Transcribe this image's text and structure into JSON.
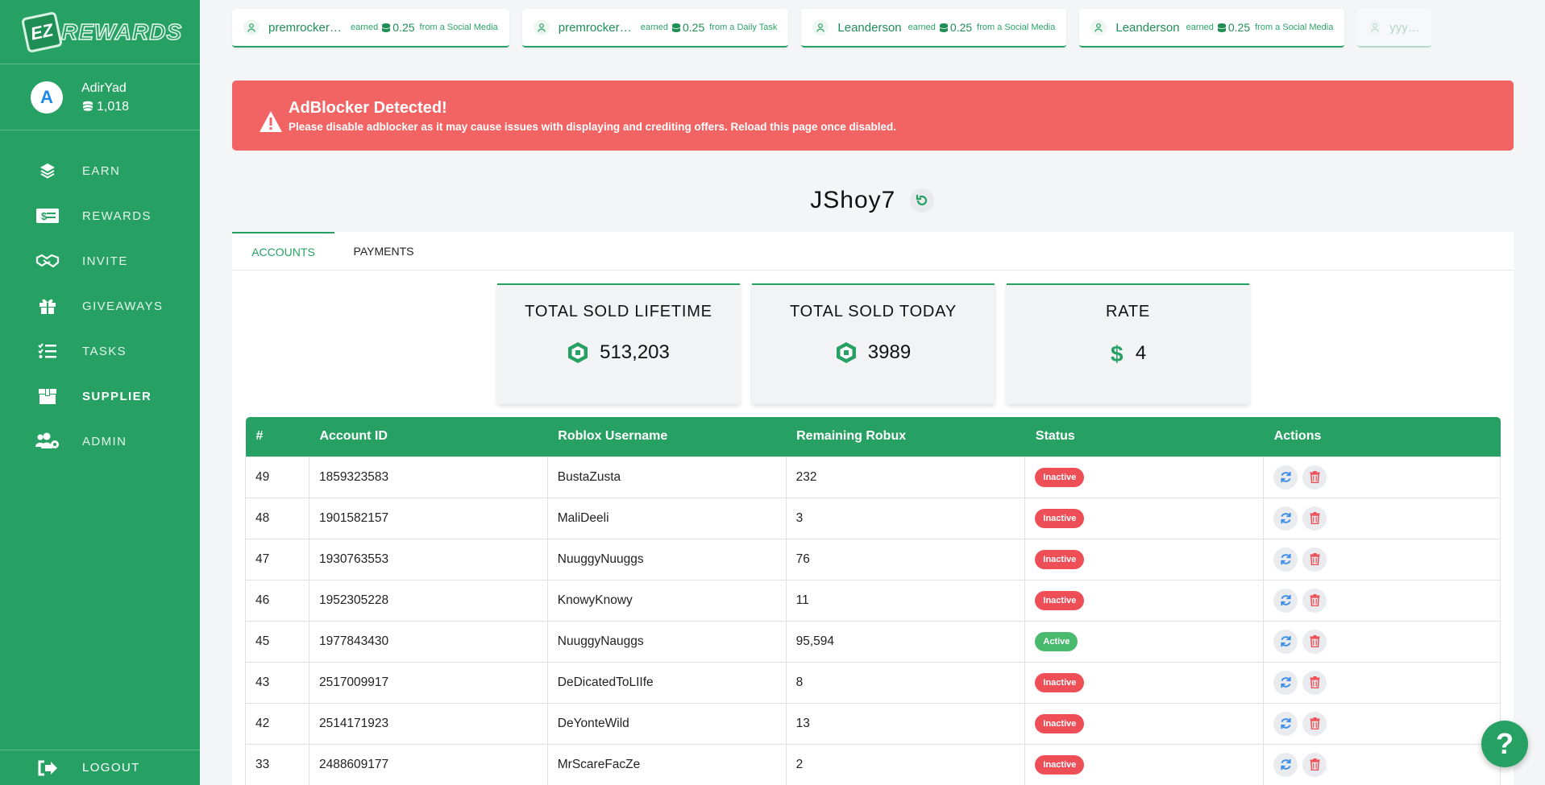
{
  "brand": {
    "badge": "EZ",
    "name": "REWARDS"
  },
  "user": {
    "avatar_letter": "A",
    "name": "AdirYad",
    "balance": "1,018"
  },
  "nav": [
    {
      "label": "EARN",
      "icon": "layers-icon",
      "active": false
    },
    {
      "label": "REWARDS",
      "icon": "money-icon",
      "active": false
    },
    {
      "label": "INVITE",
      "icon": "handshake-icon",
      "active": false
    },
    {
      "label": "GIVEAWAYS",
      "icon": "gift-icon",
      "active": false
    },
    {
      "label": "TASKS",
      "icon": "checklist-icon",
      "active": false
    },
    {
      "label": "SUPPLIER",
      "icon": "box-icon",
      "active": true
    },
    {
      "label": "ADMIN",
      "icon": "users-cog-icon",
      "active": false
    }
  ],
  "logout_label": "LOGOUT",
  "ticker": [
    {
      "name": "premrockerp...",
      "earned": "earned",
      "amount": "0.25",
      "source": "from a Social Media"
    },
    {
      "name": "premrockerp...",
      "earned": "earned",
      "amount": "0.25",
      "source": "from a Daily Task"
    },
    {
      "name": "Leanderson",
      "earned": "earned",
      "amount": "0.25",
      "source": "from a Social Media"
    },
    {
      "name": "Leanderson",
      "earned": "earned",
      "amount": "0.25",
      "source": "from a Social Media"
    },
    {
      "name": "yyyyu..."
    }
  ],
  "alert": {
    "title": "AdBlocker Detected!",
    "message": "Please disable adblocker as it may cause issues with displaying and crediting offers. Reload this page once disabled."
  },
  "supplier": {
    "name": "JShoy7"
  },
  "tabs": [
    "ACCOUNTS",
    "PAYMENTS"
  ],
  "stats": [
    {
      "title": "TOTAL SOLD LIFETIME",
      "value": "513,203",
      "icon": "robux-icon"
    },
    {
      "title": "TOTAL SOLD TODAY",
      "value": "3989",
      "icon": "robux-icon"
    },
    {
      "title": "RATE",
      "value": "4",
      "icon": "dollar-icon"
    }
  ],
  "table": {
    "headers": [
      "#",
      "Account ID",
      "Roblox Username",
      "Remaining Robux",
      "Status",
      "Actions"
    ],
    "rows": [
      {
        "num": "49",
        "account_id": "1859323583",
        "username": "BustaZusta",
        "robux": "232",
        "status": "Inactive"
      },
      {
        "num": "48",
        "account_id": "1901582157",
        "username": "MaliDeeli",
        "robux": "3",
        "status": "Inactive"
      },
      {
        "num": "47",
        "account_id": "1930763553",
        "username": "NuuggyNuuggs",
        "robux": "76",
        "status": "Inactive"
      },
      {
        "num": "46",
        "account_id": "1952305228",
        "username": "KnowyKnowy",
        "robux": "11",
        "status": "Inactive"
      },
      {
        "num": "45",
        "account_id": "1977843430",
        "username": "NuuggyNauggs",
        "robux": "95,594",
        "status": "Active"
      },
      {
        "num": "43",
        "account_id": "2517009917",
        "username": "DeDicatedToLIIfe",
        "robux": "8",
        "status": "Inactive"
      },
      {
        "num": "42",
        "account_id": "2514171923",
        "username": "DeYonteWild",
        "robux": "13",
        "status": "Inactive"
      },
      {
        "num": "33",
        "account_id": "2488609177",
        "username": "MrScareFacZe",
        "robux": "2",
        "status": "Inactive"
      }
    ]
  },
  "help_label": "?",
  "colors": {
    "brand": "#27a163",
    "alert": "#f26464",
    "inactive": "#ee4e56",
    "active": "#49b96e",
    "action_icon": "#3a8ee6",
    "delete_icon": "#ee4e56"
  }
}
